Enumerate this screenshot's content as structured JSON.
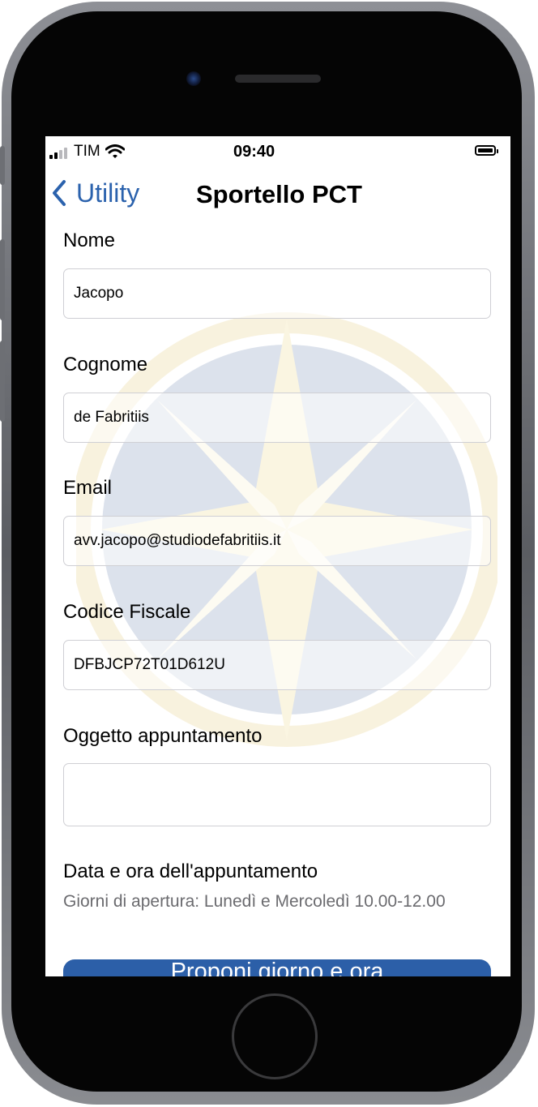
{
  "status_bar": {
    "carrier": "TIM",
    "time": "09:40"
  },
  "nav": {
    "back_label": "Utility",
    "title": "Sportello PCT"
  },
  "form": {
    "nome": {
      "label": "Nome",
      "value": "Jacopo"
    },
    "cognome": {
      "label": "Cognome",
      "value": "de Fabritiis"
    },
    "email": {
      "label": "Email",
      "value": "avv.jacopo@studiodefabritiis.it"
    },
    "codice_fiscale": {
      "label": "Codice Fiscale",
      "value": "DFBJCP72T01D612U"
    },
    "oggetto": {
      "label": "Oggetto appuntamento",
      "value": ""
    },
    "appointment": {
      "label": "Data e ora dell'appuntamento",
      "note": "Giorni di apertura: Lunedì e Mercoledì 10.00-12.00"
    },
    "propose_button": "Proponi giorno e ora"
  },
  "colors": {
    "accent": "#2b62ad",
    "button": "#2c5fa8",
    "note_text": "#6b6b6f"
  },
  "icons": {
    "back": "chevron-left-icon",
    "wifi": "wifi-icon",
    "battery": "battery-icon",
    "signal": "cellular-signal-icon"
  }
}
